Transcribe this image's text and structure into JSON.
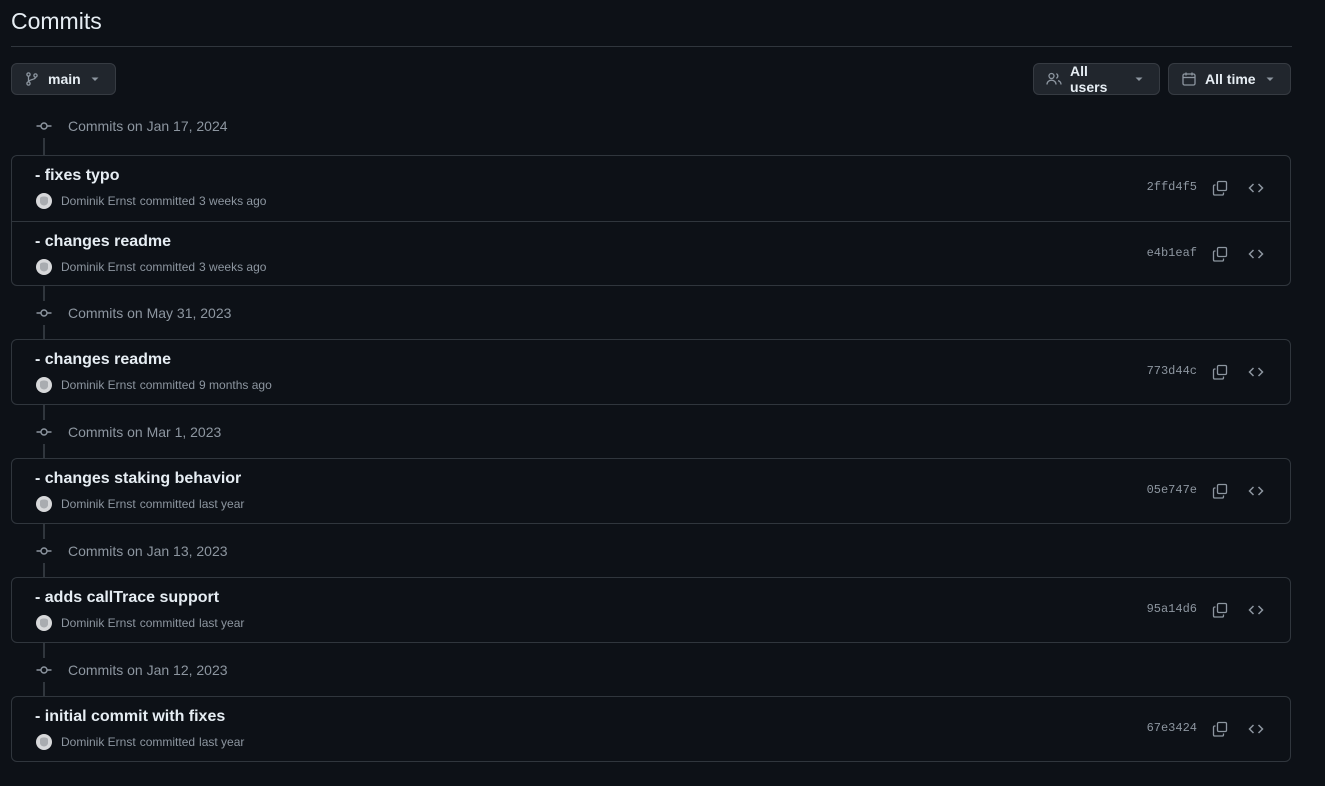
{
  "page": {
    "title": "Commits"
  },
  "filters": {
    "branch": {
      "label": "main",
      "icon": "git-branch-icon"
    },
    "users": {
      "label": "All users",
      "icon": "people-icon"
    },
    "time": {
      "label": "All time",
      "icon": "calendar-icon"
    }
  },
  "groups": [
    {
      "label": "Commits on Jan 17, 2024",
      "commits": [
        {
          "message": "- fixes typo",
          "author": "Dominik Ernst",
          "verb": "committed",
          "when": "3 weeks ago",
          "sha": "2ffd4f5"
        },
        {
          "message": "- changes readme",
          "author": "Dominik Ernst",
          "verb": "committed",
          "when": "3 weeks ago",
          "sha": "e4b1eaf"
        }
      ]
    },
    {
      "label": "Commits on May 31, 2023",
      "commits": [
        {
          "message": "- changes readme",
          "author": "Dominik Ernst",
          "verb": "committed",
          "when": "9 months ago",
          "sha": "773d44c"
        }
      ]
    },
    {
      "label": "Commits on Mar 1, 2023",
      "commits": [
        {
          "message": "- changes staking behavior",
          "author": "Dominik Ernst",
          "verb": "committed",
          "when": "last year",
          "sha": "05e747e"
        }
      ]
    },
    {
      "label": "Commits on Jan 13, 2023",
      "commits": [
        {
          "message": "- adds callTrace support",
          "author": "Dominik Ernst",
          "verb": "committed",
          "when": "last year",
          "sha": "95a14d6"
        }
      ]
    },
    {
      "label": "Commits on Jan 12, 2023",
      "commits": [
        {
          "message": "- initial commit with fixes",
          "author": "Dominik Ernst",
          "verb": "committed",
          "when": "last year",
          "sha": "67e3424"
        }
      ]
    }
  ],
  "colors": {
    "background": "#0d1117",
    "border": "#30363d",
    "text": "#e6edf3",
    "muted": "#8d96a0",
    "button_bg": "#21262d"
  }
}
